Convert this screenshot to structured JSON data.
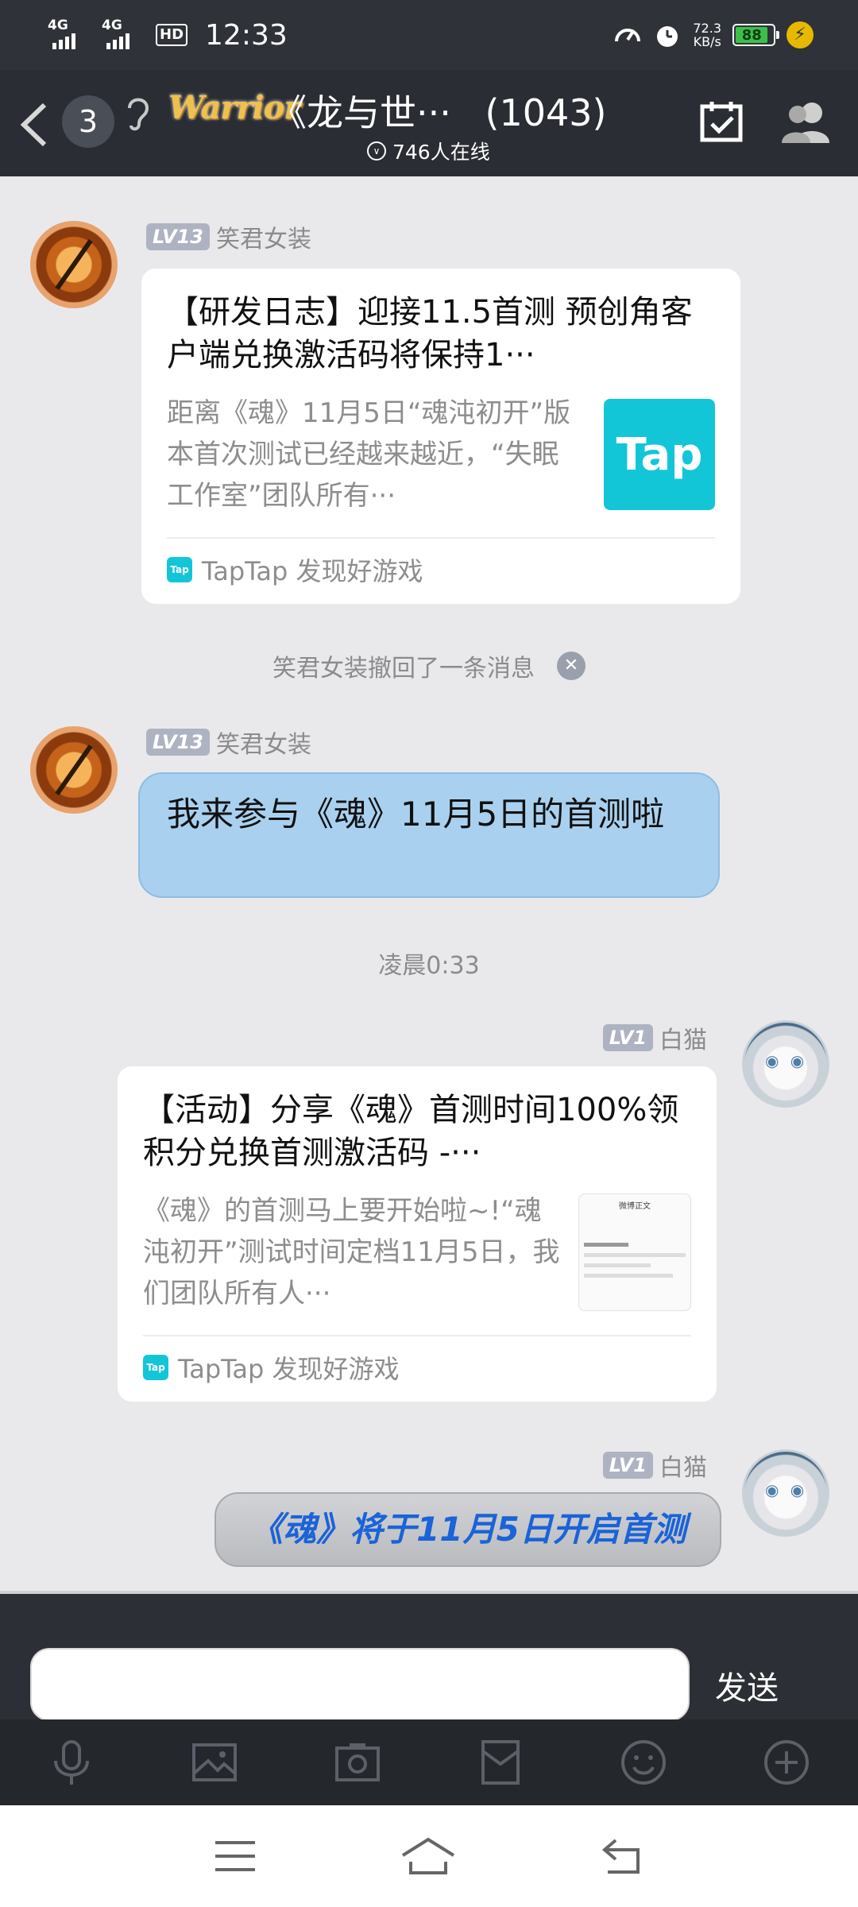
{
  "status_bar": {
    "net1": "4G",
    "net2": "4G",
    "hd": "HD",
    "time": "12:33",
    "speed_value": "72.3",
    "speed_unit": "KB/s",
    "battery": "88"
  },
  "header": {
    "unread_count": "3",
    "logo_text": "Warrior",
    "group_name": "《龙与世···",
    "member_count": "(1043)",
    "online": "746人在线"
  },
  "messages": {
    "m1": {
      "level": "LV13",
      "sender": "笑君女装",
      "card_title": "【研发日志】迎接11.5首测 预创角客户端兑换激活码将保持1···",
      "card_desc": "距离《魂》11月5日“魂沌初开”版本首次测试已经越来越近，“失眠工作室”团队所有···",
      "thumb_text": "Tap",
      "source": "TapTap 发现好游戏",
      "source_icon": "Tap"
    },
    "recall": "笑君女装撤回了一条消息",
    "m2": {
      "level": "LV13",
      "sender": "笑君女装",
      "text": "我来参与《魂》11月5日的首测啦"
    },
    "timestamp": "凌晨0:33",
    "m3": {
      "level": "LV1",
      "sender": "白猫",
      "card_title": "【活动】分享《魂》首测时间100%领积分兑换首测激活码 -···",
      "card_desc": "《魂》的首测马上要开始啦~!“魂沌初开”测试时间定档11月5日，我们团队所有人···",
      "thumb_head": "微博正文",
      "source": "TapTap 发现好游戏",
      "source_icon": "Tap"
    },
    "m4": {
      "level": "LV1",
      "sender": "白猫",
      "text": "《魂》将于11月5日开启首测"
    }
  },
  "input": {
    "value": "",
    "send_label": "发送"
  },
  "colors": {
    "bubble_blue": "#a9d1ef",
    "tap_cyan": "#12c6d8",
    "header_bg": "#2a2d33"
  }
}
